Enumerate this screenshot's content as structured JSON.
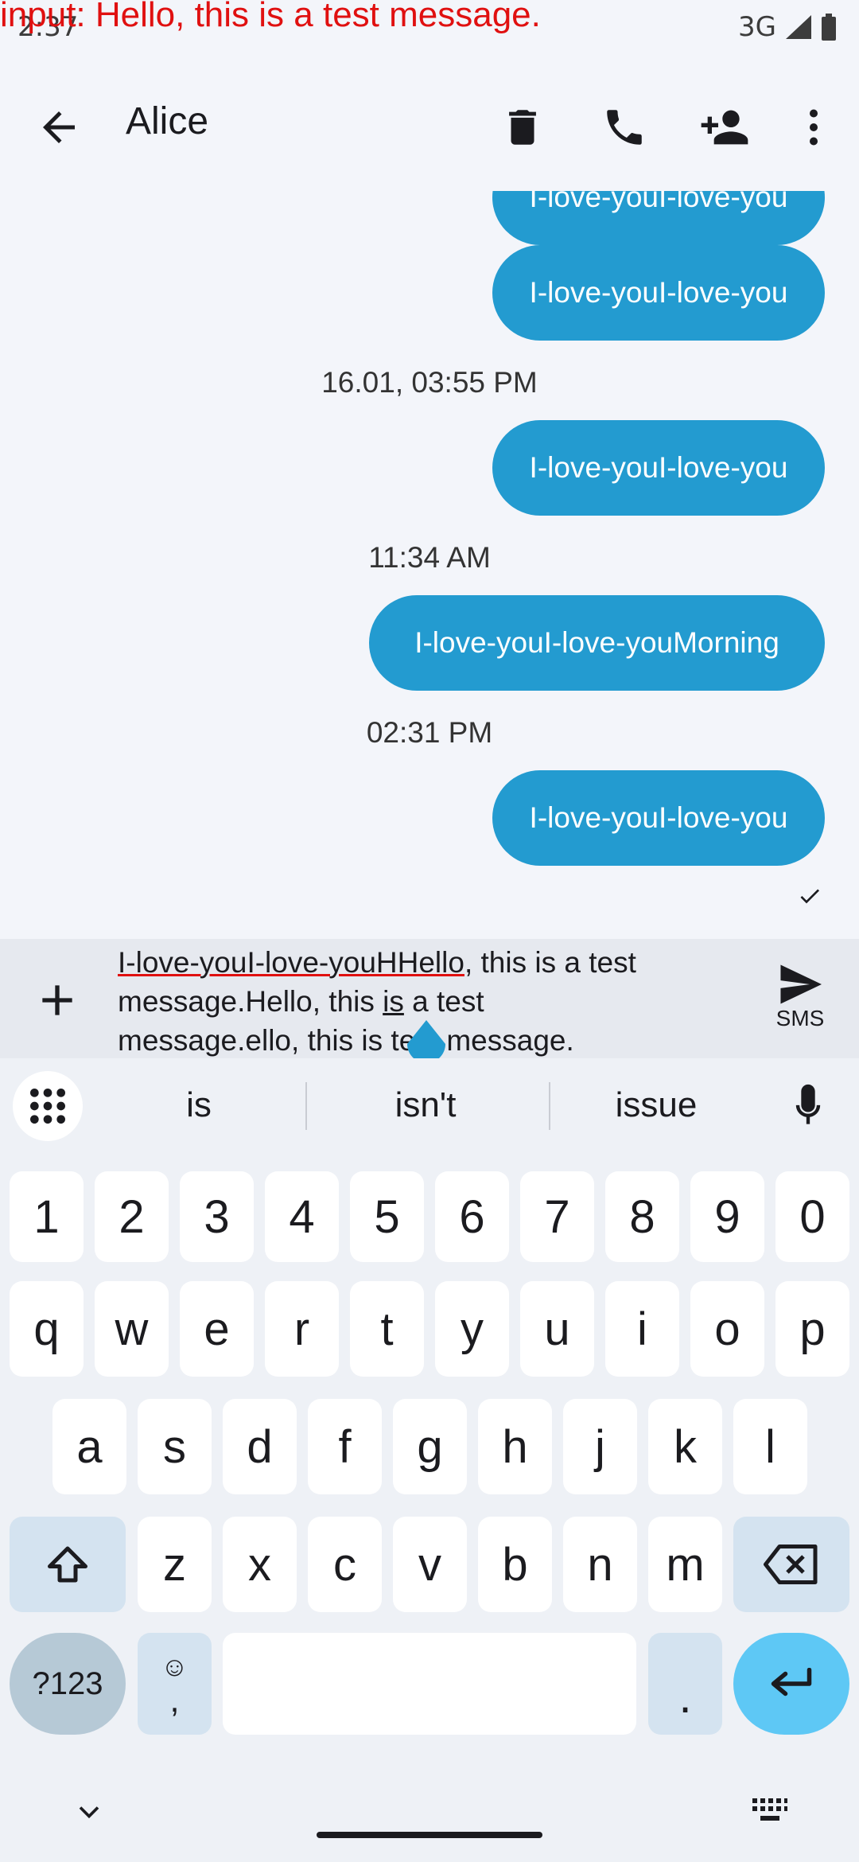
{
  "status_bar": {
    "time": "2:37",
    "network": "3G",
    "debug_input_text": "input: Hello, this is a test message."
  },
  "toolbar": {
    "title": "Alice",
    "icons": [
      "arrow-back-icon",
      "delete-icon",
      "phone-icon",
      "add-person-icon",
      "more-vert-icon"
    ]
  },
  "messages": [
    {
      "text": "I-love-youI-love-you",
      "type": "outgoing",
      "partially_visible": true
    },
    {
      "text": "I-love-youI-love-you",
      "type": "outgoing"
    },
    {
      "timestamp": "16.01, 03:55 PM"
    },
    {
      "text": "I-love-youI-love-you",
      "type": "outgoing"
    },
    {
      "timestamp": "11:34 AM"
    },
    {
      "text": "I-love-youI-love-youMorning",
      "type": "outgoing"
    },
    {
      "timestamp": "02:31 PM"
    },
    {
      "text": "I-love-youI-love-you",
      "type": "outgoing",
      "status": "sent"
    }
  ],
  "composer": {
    "line1_underlined": "I-love-youI-love-youHHello",
    "line1_rest": ", this is a test",
    "line2_a": "message.Hello, this ",
    "line2_cursor_word": "is",
    "line2_b": " a test",
    "line3_a": "message.ello, this is",
    "line3_b": " test message.",
    "send_label": "SMS"
  },
  "keyboard": {
    "suggestions": [
      "is",
      "isn't",
      "issue"
    ],
    "number_row": [
      "1",
      "2",
      "3",
      "4",
      "5",
      "6",
      "7",
      "8",
      "9",
      "0"
    ],
    "row1": [
      "q",
      "w",
      "e",
      "r",
      "t",
      "y",
      "u",
      "i",
      "o",
      "p"
    ],
    "row2": [
      "a",
      "s",
      "d",
      "f",
      "g",
      "h",
      "j",
      "k",
      "l"
    ],
    "row3": [
      "z",
      "x",
      "c",
      "v",
      "b",
      "n",
      "m"
    ],
    "symbols_key": "?123",
    "emoji_comma_top": "☺",
    "emoji_comma_bottom": ",",
    "period_key": "."
  },
  "colors": {
    "bubble": "#239bd0",
    "accent_enter": "#5ec8f5",
    "debug_text": "#e01010"
  }
}
